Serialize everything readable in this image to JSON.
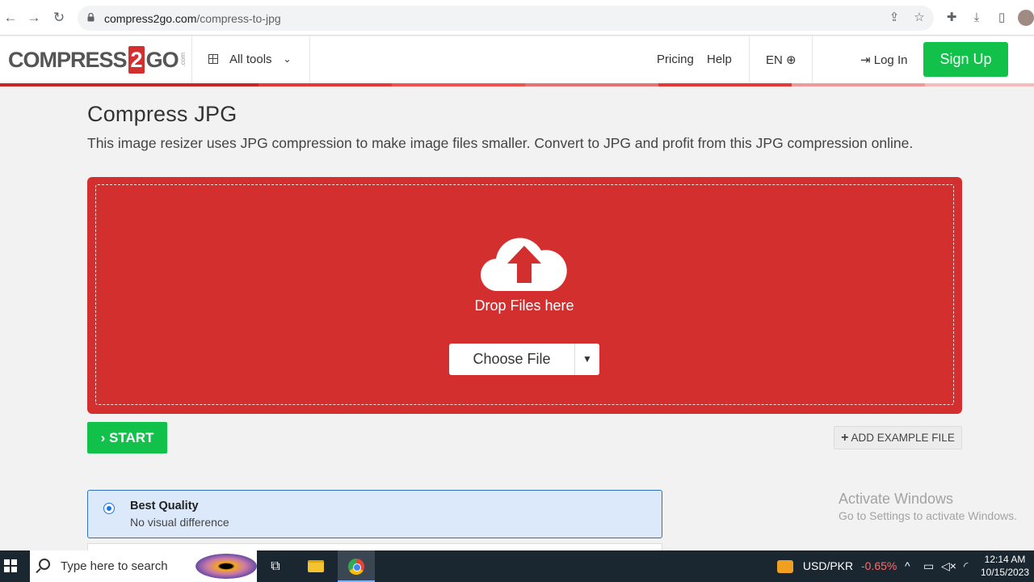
{
  "browser": {
    "url_domain": "compress2go.com",
    "url_path": "/compress-to-jpg",
    "back_icon": "←",
    "forward_icon": "→",
    "reload_icon": "↻"
  },
  "header": {
    "logo_part1": "COMPRESS",
    "logo_part2": "2",
    "logo_part3": "GO",
    "logo_suffix": ".com",
    "all_tools": "All tools",
    "pricing": "Pricing",
    "help": "Help",
    "language": "EN",
    "login": "Log In",
    "signup": "Sign Up"
  },
  "main": {
    "title": "Compress JPG",
    "subtitle": "This image resizer uses JPG compression to make image files smaller. Convert to JPG and profit from this JPG compression online.",
    "drop_text": "Drop Files here",
    "choose_file": "Choose File",
    "start": "START",
    "add_example": "ADD EXAMPLE FILE",
    "option_title": "Best Quality",
    "option_sub": "No visual difference"
  },
  "watermark": {
    "title": "Activate Windows",
    "sub": "Go to Settings to activate Windows."
  },
  "taskbar": {
    "search_placeholder": "Type here to search",
    "currency": "USD/PKR",
    "change": "-0.65%",
    "time": "12:14 AM",
    "date": "10/15/2023"
  },
  "colors": {
    "brand_red": "#d32f2f",
    "accent_green": "#11c14a"
  }
}
